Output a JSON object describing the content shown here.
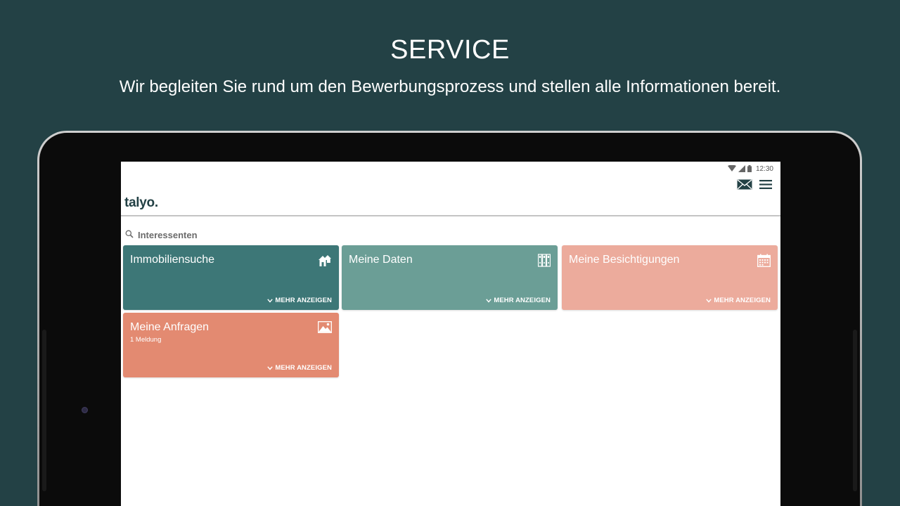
{
  "promo": {
    "title": "SERVICE",
    "subtitle": "Wir begleiten Sie rund um den Bewerbungsprozess und stellen alle Informationen bereit."
  },
  "status_bar": {
    "time": "12:30",
    "icons": [
      "wifi-icon",
      "signal-icon",
      "battery-icon"
    ]
  },
  "app": {
    "logo": "talyo.",
    "header_icons": [
      "mail-icon",
      "menu-icon"
    ]
  },
  "section": {
    "icon": "search-icon",
    "label": "Interessenten"
  },
  "tiles": [
    {
      "title": "Immobiliensuche",
      "subtitle": "",
      "more": "MEHR ANZEIGEN",
      "icon": "houses-icon",
      "color": "#3d7777"
    },
    {
      "title": "Meine Daten",
      "subtitle": "",
      "more": "MEHR ANZEIGEN",
      "icon": "binders-icon",
      "color": "#6b9e96"
    },
    {
      "title": "Meine Besichtigungen",
      "subtitle": "",
      "more": "MEHR ANZEIGEN",
      "icon": "calendar-icon",
      "color": "#ecab9c"
    },
    {
      "title": "Meine Anfragen",
      "subtitle": "1 Meldung",
      "more": "MEHR ANZEIGEN",
      "icon": "envelope-image-icon",
      "color": "#e38a71"
    }
  ],
  "colors": {
    "background": "#234145",
    "logo": "#234145"
  }
}
